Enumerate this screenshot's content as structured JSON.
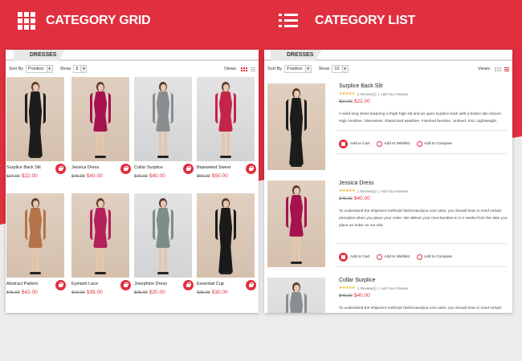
{
  "colors": {
    "accent": "#e0303f",
    "background_gray": "#ececec",
    "star": "#f2b01e"
  },
  "headers": {
    "grid": {
      "icon": "grid-icon",
      "label": "CATEGORY GRID"
    },
    "list": {
      "icon": "list-icon",
      "label": "CATEGORY LIST"
    }
  },
  "grid_panel": {
    "tab": "DRESSES",
    "sort_label": "Sort By",
    "sort_value": "Position",
    "show_label": "Show",
    "show_value": "8",
    "views_label": "Views:",
    "products": [
      {
        "name": "Surplice Back Slit",
        "old_price": "$24.00",
        "price": "$22.00",
        "dress_color": "#1c1c1c"
      },
      {
        "name": "Jessica Dress",
        "old_price": "$45.00",
        "price": "$40.00",
        "dress_color": "#a5124f"
      },
      {
        "name": "Collar Surplice",
        "old_price": "$45.00",
        "price": "$40.00",
        "dress_color": "#8a8d90"
      },
      {
        "name": "Bejeweled Sweet",
        "old_price": "$56.00",
        "price": "$50.00",
        "dress_color": "#c4234a"
      },
      {
        "name": "Abstract Pattern",
        "old_price": "$45.00",
        "price": "$42.00",
        "dress_color": "#b5734a"
      },
      {
        "name": "Eyelash Lace",
        "old_price": "$43.00",
        "price": "$39.00",
        "dress_color": "#b3205a"
      },
      {
        "name": "Josephine Dress",
        "old_price": "$25.00",
        "price": "$20.00",
        "dress_color": "#7d8c84"
      },
      {
        "name": "Essential Cup",
        "old_price": "$35.00",
        "price": "$30.00",
        "dress_color": "#1a1a1a"
      }
    ]
  },
  "list_panel": {
    "tab": "DRESSES",
    "sort_label": "Sort By",
    "sort_value": "Position",
    "show_label": "Show",
    "show_value": "10",
    "views_label": "Views:",
    "add_to_cart": "Add to Cart",
    "add_to_wishlist": "Add to Wishlist",
    "add_to_compare": "Add to Compare",
    "products": [
      {
        "name": "Surplice Back Slit",
        "stars": "★★★★★",
        "reviews": "2 Review(s)",
        "add_review": "Add Your Review",
        "old_price": "$24.00",
        "price": "$22.00",
        "desc": "A solid long dress featuring a thigh-high slit and an open surplice back with a button tab closure. High neckline. Sleeveless. Elasticized waistline. Finished hemline. Unlined. Knit. Lightweight.",
        "dress_color": "#1c1c1c"
      },
      {
        "name": "Jessica Dress",
        "stars": "★★★★★",
        "reviews": "1 Review(s)",
        "add_review": "Add Your Review",
        "old_price": "$45.00",
        "price": "$40.00",
        "desc": "To understand the shipment methods fashionandyou.com uses, you should bear in mind certain principles when you place your order. We deliver your merchandise in 3-4 weeks from the date you place an order on our site.",
        "dress_color": "#a5124f"
      },
      {
        "name": "Collar Surplice",
        "stars": "★★★★★",
        "reviews": "1 Review(s)",
        "add_review": "Add Your Review",
        "old_price": "$45.00",
        "price": "$40.00",
        "desc": "To understand the shipment methods fashionandyou.com uses, you should bear in mind certain",
        "dress_color": "#8a8d90"
      }
    ]
  }
}
